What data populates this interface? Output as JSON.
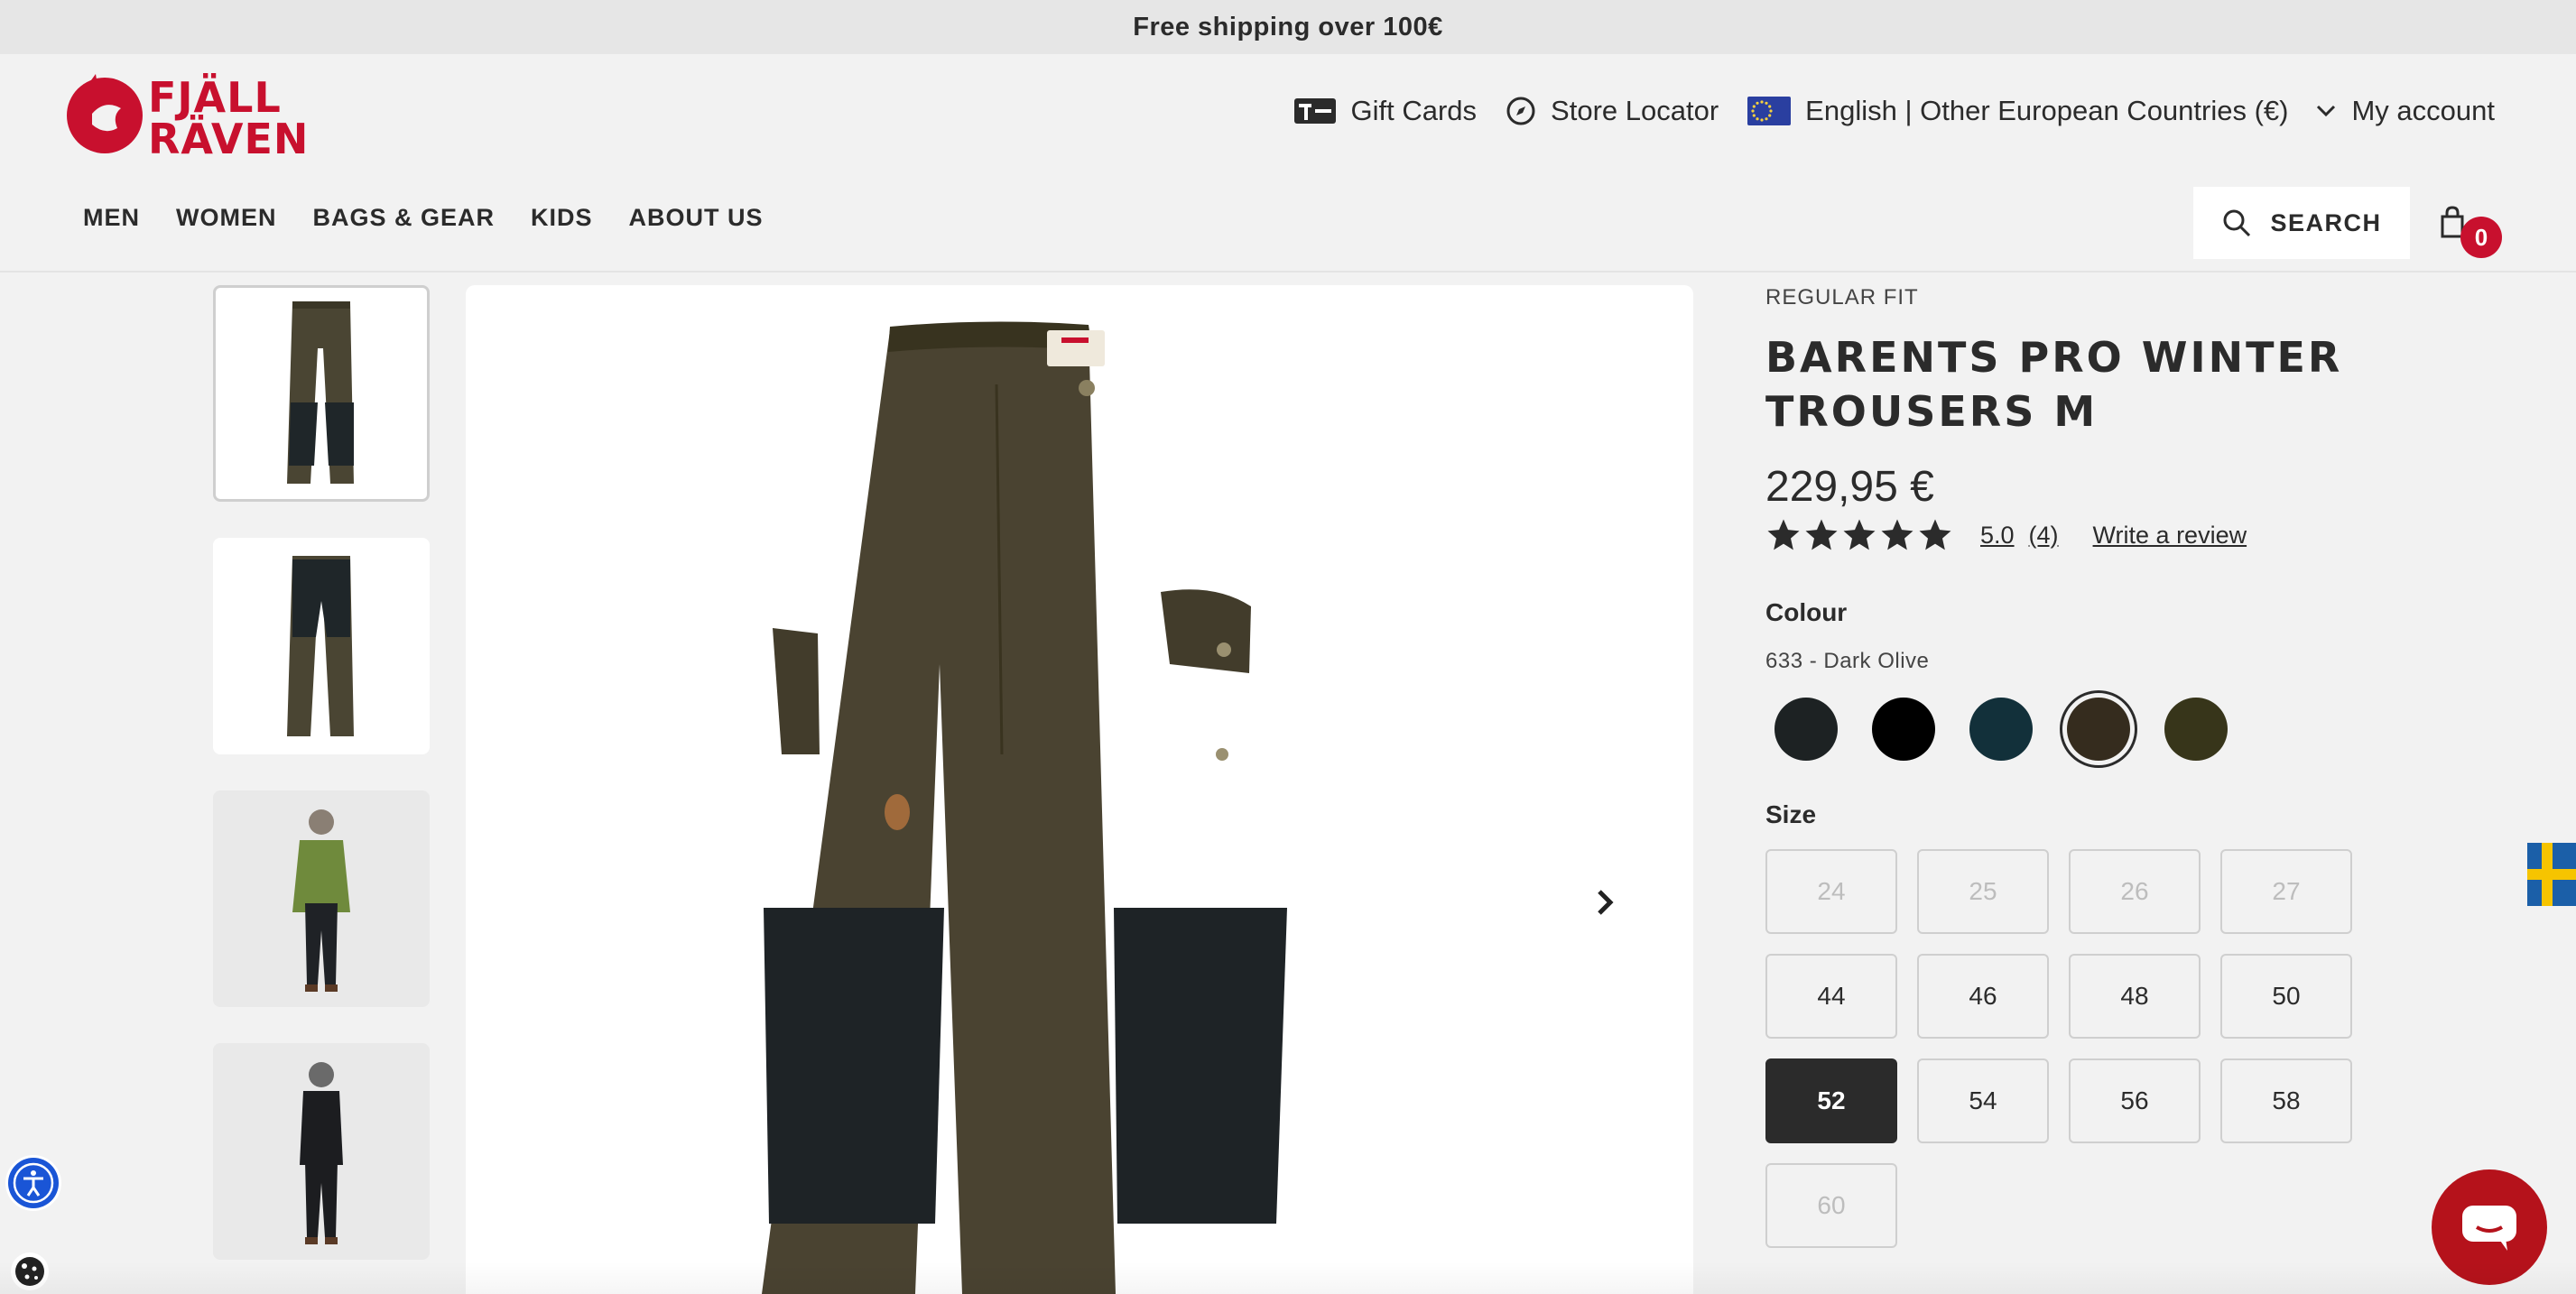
{
  "announcement": "Free shipping over 100€",
  "brand": {
    "logo_text": "FJÄLL RÄVEN",
    "color": "#c8102e"
  },
  "utility_nav": {
    "gift_cards": "Gift Cards",
    "store_locator": "Store Locator",
    "region": "English | Other European Countries (€)",
    "my_account": "My account"
  },
  "main_nav": [
    "MEN",
    "WOMEN",
    "BAGS & GEAR",
    "KIDS",
    "ABOUT US"
  ],
  "search": {
    "label": "SEARCH"
  },
  "cart": {
    "count": "0"
  },
  "product": {
    "fit": "REGULAR FIT",
    "title_line1": "BARENTS PRO WINTER",
    "title_line2": "TROUSERS M",
    "price": "229,95 €",
    "rating": "5.0",
    "review_count": "(4)",
    "write_review": "Write a review",
    "stars": 5,
    "colour_label": "Colour",
    "colour_value": "633 - Dark Olive",
    "colours": [
      {
        "name": "dark-grey",
        "hex": "#1d2223"
      },
      {
        "name": "black",
        "hex": "#000000"
      },
      {
        "name": "dark-navy",
        "hex": "#12303a"
      },
      {
        "name": "dark-olive",
        "hex": "#352c1e",
        "selected": true
      },
      {
        "name": "deep-forest",
        "hex": "#37351a"
      }
    ],
    "size_label": "Size",
    "sizes": [
      {
        "label": "24",
        "state": "disabled"
      },
      {
        "label": "25",
        "state": "disabled"
      },
      {
        "label": "26",
        "state": "disabled"
      },
      {
        "label": "27",
        "state": "disabled"
      },
      {
        "label": "44",
        "state": "available"
      },
      {
        "label": "46",
        "state": "available"
      },
      {
        "label": "48",
        "state": "available"
      },
      {
        "label": "50",
        "state": "available"
      },
      {
        "label": "52",
        "state": "selected"
      },
      {
        "label": "54",
        "state": "available"
      },
      {
        "label": "56",
        "state": "available"
      },
      {
        "label": "58",
        "state": "available"
      },
      {
        "label": "60",
        "state": "disabled"
      }
    ]
  },
  "gallery": {
    "thumbnails": [
      "trousers-front",
      "trousers-back",
      "model-front",
      "model-back"
    ],
    "active_index": 0
  }
}
